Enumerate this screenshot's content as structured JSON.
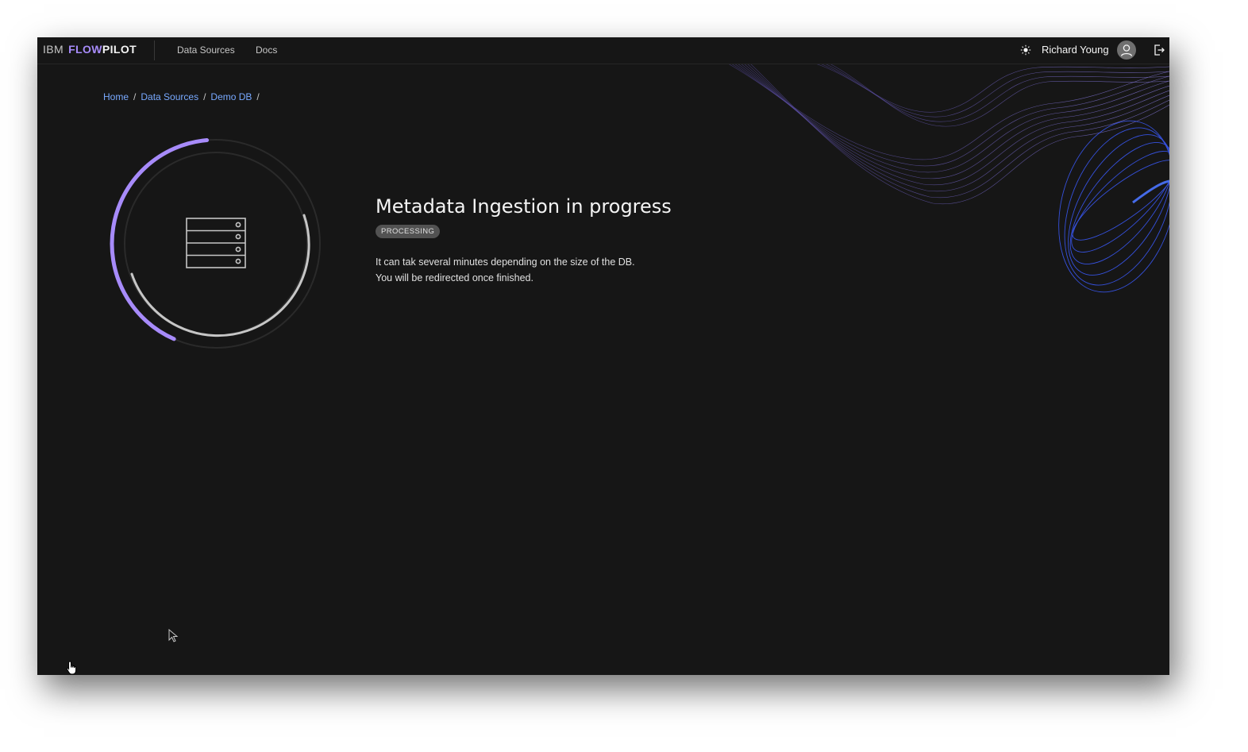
{
  "brand": {
    "company": "IBM",
    "product_part1": "FLOW",
    "product_part2": "PILOT"
  },
  "nav": {
    "items": [
      {
        "label": "Data Sources"
      },
      {
        "label": "Docs"
      }
    ]
  },
  "user": {
    "name": "Richard Young"
  },
  "icons": {
    "theme": "theme-toggle-icon",
    "avatar": "user-avatar-icon",
    "logout": "logout-icon",
    "database": "database-icon",
    "cursor": "pointer-cursor-icon"
  },
  "breadcrumb": {
    "items": [
      "Home",
      "Data Sources",
      "Demo DB"
    ],
    "separator": "/"
  },
  "progress": {
    "fraction": 0.42
  },
  "main": {
    "title": "Metadata Ingestion in progress",
    "status_tag": "PROCESSING",
    "description_line1": "It can tak several minutes depending on the size of the DB.",
    "description_line2": "You will be redirected once finished."
  },
  "colors": {
    "background": "#161616",
    "accent_purple": "#a78bfa",
    "link_blue": "#78a9ff",
    "wave_blue": "#3b5bff"
  }
}
